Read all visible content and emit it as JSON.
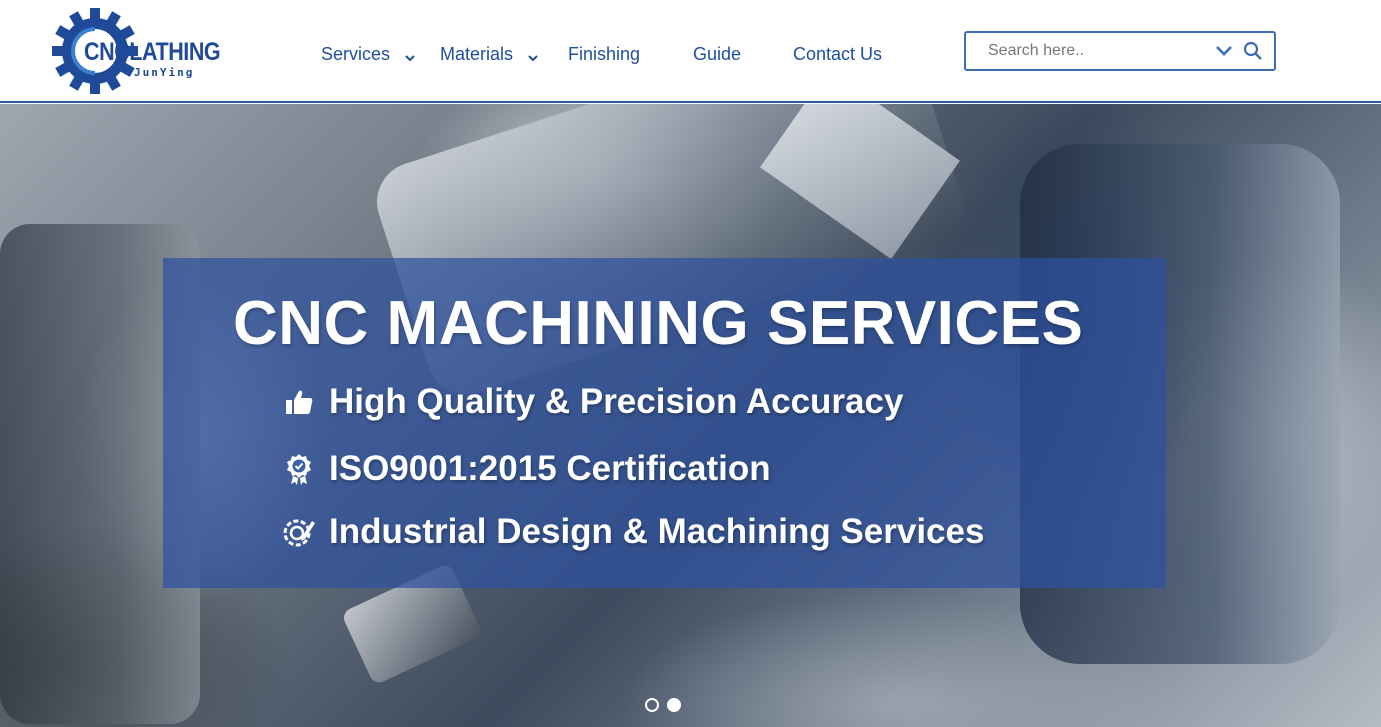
{
  "brand": {
    "name": "CNCLATHING",
    "sub": "JunYing",
    "color": "#1f4a9a"
  },
  "nav": {
    "items": [
      {
        "label": "Services",
        "has_dropdown": true
      },
      {
        "label": "Materials",
        "has_dropdown": true
      },
      {
        "label": "Finishing",
        "has_dropdown": false
      },
      {
        "label": "Guide",
        "has_dropdown": false
      },
      {
        "label": "Contact Us",
        "has_dropdown": false
      }
    ],
    "color": "#1e4f9e"
  },
  "search": {
    "placeholder": "Search here..",
    "value": "",
    "icons": [
      "chevron-down-icon",
      "search-icon"
    ]
  },
  "hero": {
    "title": "CNC MACHINING SERVICES",
    "features": [
      {
        "icon": "thumbs-up-icon",
        "text": "High Quality & Precision Accuracy"
      },
      {
        "icon": "certificate-badge-icon",
        "text": "ISO9001:2015 Certification"
      },
      {
        "icon": "design-gear-icon",
        "text": "Industrial Design & Machining Services"
      }
    ],
    "panel_color": "#2e52a0"
  },
  "carousel": {
    "slides": 2,
    "active_slide": 2
  }
}
